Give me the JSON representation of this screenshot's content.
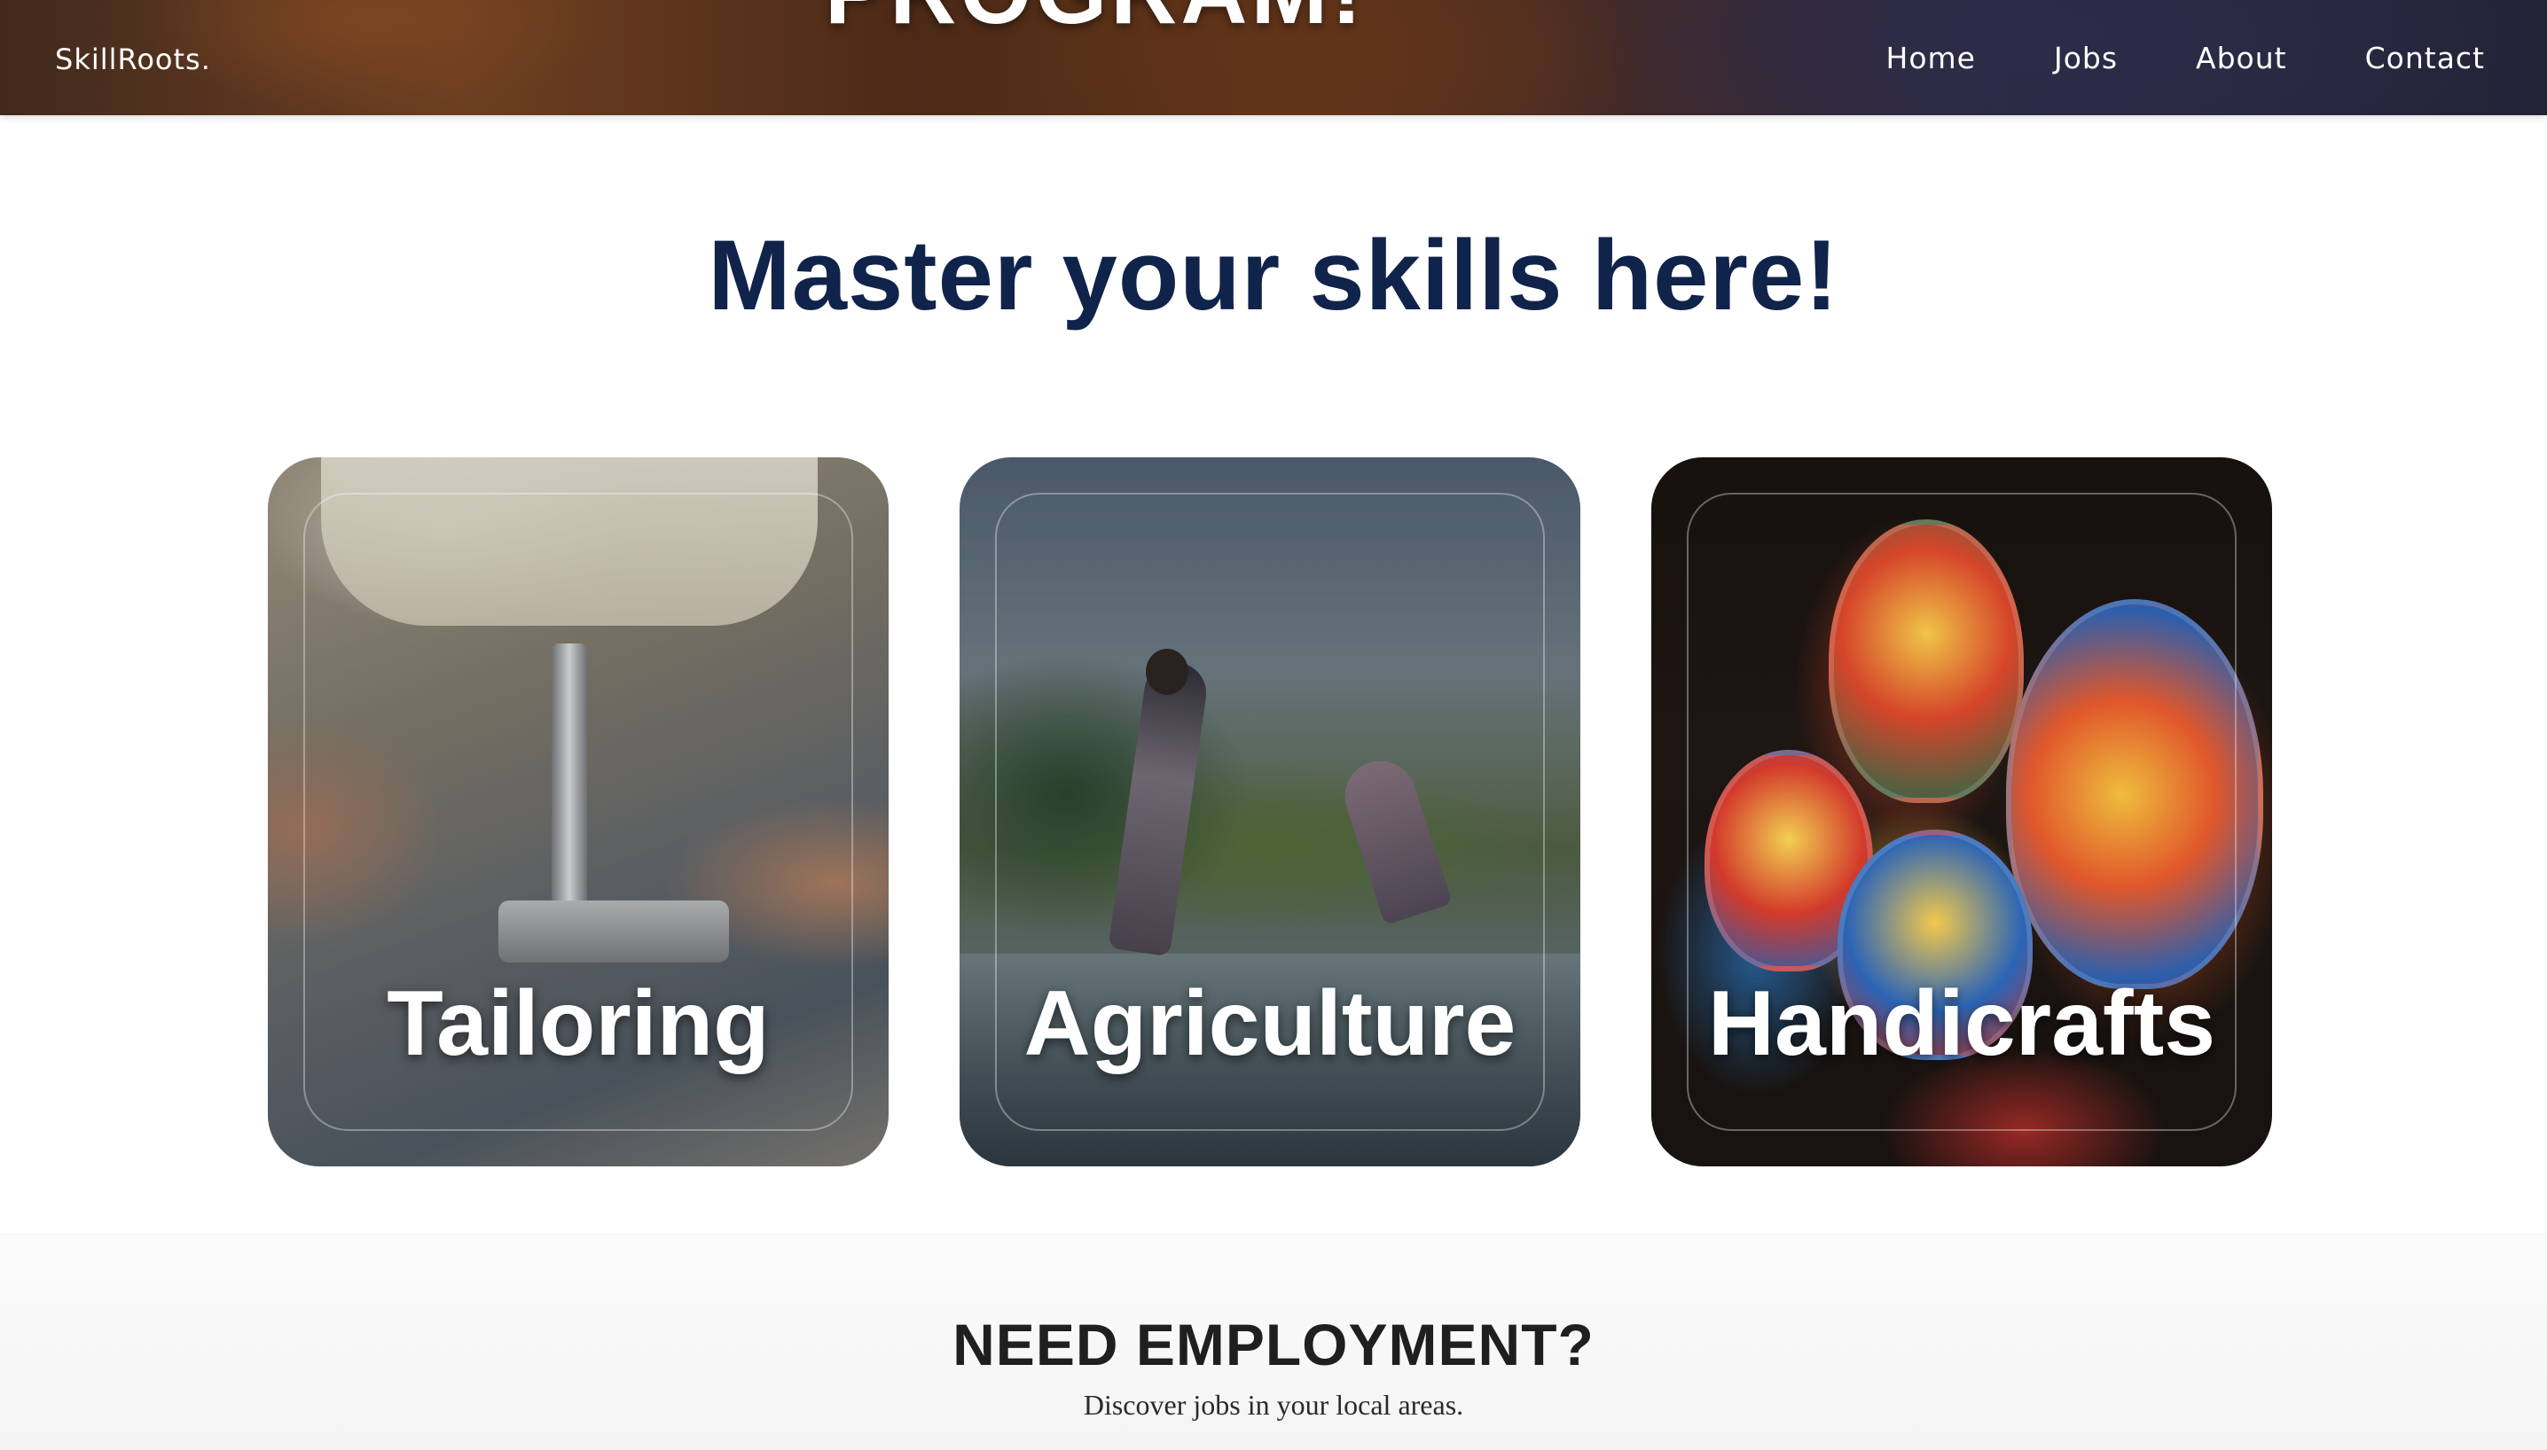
{
  "navbar": {
    "brand": "SkillRoots.",
    "hero_title_fragment": "PROGRAM!",
    "links": [
      {
        "label": "Home"
      },
      {
        "label": "Jobs"
      },
      {
        "label": "About"
      },
      {
        "label": "Contact"
      }
    ]
  },
  "skills": {
    "title": "Master your skills here!",
    "cards": [
      {
        "label": "Tailoring",
        "image": "sewing-machine-photo"
      },
      {
        "label": "Agriculture",
        "image": "rice-field-farmers-photo"
      },
      {
        "label": "Handicrafts",
        "image": "painted-clay-pots-photo"
      }
    ]
  },
  "employment": {
    "title": "NEED EMPLOYMENT?",
    "subtitle": "Discover jobs in your local areas."
  },
  "colors": {
    "heading": "#10234a",
    "nav_text": "#ffffff",
    "employment_title": "#1f1f1f"
  }
}
